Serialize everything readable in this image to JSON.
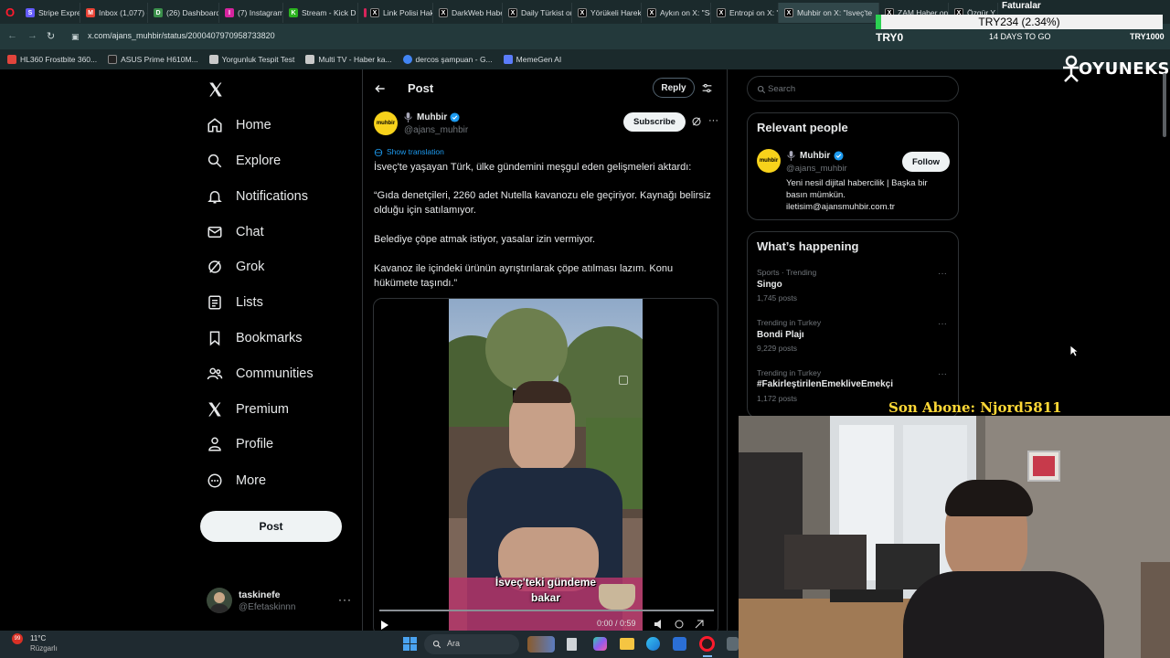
{
  "browser": {
    "tabs": [
      {
        "label": "Stripe Express",
        "color": "#635bff"
      },
      {
        "label": "Inbox (1,077) - ",
        "color": "#ea4335"
      },
      {
        "label": "(26) Dashboard",
        "color": "#3a8f4b"
      },
      {
        "label": "(7) Instagram",
        "color": "#d6249f"
      },
      {
        "label": "Stream - Kick D",
        "color": "#53fc18"
      },
      {
        "label": "Link Polisi Haka",
        "color": "#000000"
      },
      {
        "label": "DarkWeb Haber",
        "color": "#000000"
      },
      {
        "label": "Daily Türkist on",
        "color": "#000000"
      },
      {
        "label": "Yörükeli Hareke",
        "color": "#000000"
      },
      {
        "label": "Aykın on X: \"Sol",
        "color": "#000000"
      },
      {
        "label": "Entropi on X: \"h",
        "color": "#000000"
      },
      {
        "label": "Muhbir on X: \"Isveç'te",
        "color": "#000000"
      },
      {
        "label": "ZAM Haber on",
        "color": "#000000"
      },
      {
        "label": "Özgür Y",
        "color": "#000000"
      }
    ],
    "url": "x.com/ajans_muhbir/status/2000407970958733820",
    "bookmarks": [
      "HL360 Frostbite 360...",
      "ASUS Prime H610M...",
      "Yorgunluk Tespit Test",
      "Multi TV - Haber ka...",
      "dercos şampuan - G...",
      "MemeGen AI"
    ]
  },
  "overlay": {
    "faturalar": "Faturalar",
    "stock": "TRY234 (2.34%)",
    "try0": "TRY0",
    "days_to_go": "14 DAYS TO GO",
    "try100": "TRY1000",
    "oyuneks": "OYUNEKS",
    "son_abone": "Son Abone: Njord5811"
  },
  "nav": {
    "items": [
      {
        "label": "Home",
        "icon": "home-icon"
      },
      {
        "label": "Explore",
        "icon": "search-icon"
      },
      {
        "label": "Notifications",
        "icon": "bell-icon"
      },
      {
        "label": "Chat",
        "icon": "mail-icon"
      },
      {
        "label": "Grok",
        "icon": "grok-icon"
      },
      {
        "label": "Lists",
        "icon": "list-icon"
      },
      {
        "label": "Bookmarks",
        "icon": "bookmark-icon"
      },
      {
        "label": "Communities",
        "icon": "people-icon"
      },
      {
        "label": "Premium",
        "icon": "x-icon"
      },
      {
        "label": "Profile",
        "icon": "person-icon"
      },
      {
        "label": "More",
        "icon": "more-icon"
      }
    ],
    "post_label": "Post",
    "account_name": "taskinefe",
    "account_handle": "@Efetaskinnn"
  },
  "post": {
    "header_title": "Post",
    "reply_label": "Reply",
    "author_name": "Muhbir",
    "author_handle": "@ajans_muhbir",
    "avatar_text": "muhbir",
    "subscribe_label": "Subscribe",
    "show_translation": "Show translation",
    "paragraphs": [
      "İsveç'te yaşayan Türk, ülke gündemini meşgul eden gelişmeleri aktardı:",
      "“Gıda denetçileri, 2260 adet Nutella kavanozu ele geçiriyor. Kaynağı belirsiz olduğu için satılamıyor.",
      "Belediye çöpe atmak istiyor, yasalar izin vermiyor.",
      "Kavanoz ile içindeki ürünün ayrıştırılarak çöpe atılması lazım. Konu hükümete taşındı.”"
    ],
    "video_caption_1": "İsveç'teki gündeme",
    "video_caption_2": "bakar",
    "video_time": "0:00 / 0:59"
  },
  "right": {
    "search_placeholder": "Search",
    "relevant_title": "Relevant people",
    "relevant_name": "Muhbir",
    "relevant_handle": "@ajans_muhbir",
    "relevant_bio": "Yeni nesil dijital habercilik | Başka bir basın mümkün. iletisim@ajansmuhbir.com.tr",
    "follow_label": "Follow",
    "happening_title": "What’s happening",
    "trends": [
      {
        "category": "Sports · Trending",
        "name": "Singo",
        "posts": "1,745 posts"
      },
      {
        "category": "Trending in Turkey",
        "name": "Bondi Plajı",
        "posts": "9,229 posts"
      },
      {
        "category": "Trending in Turkey",
        "name": "#FakirleştirilenEmekliveEmekçi",
        "posts": "1,172 posts"
      }
    ]
  },
  "taskbar": {
    "temperature": "11°C",
    "weather": "Rüzgarlı",
    "search_placeholder": "Ara",
    "notification_count": "99"
  },
  "colors": {
    "accent_blue": "#1d9bf0",
    "verified": "#1d9bf0",
    "avatar_yellow": "#f7d21b"
  }
}
